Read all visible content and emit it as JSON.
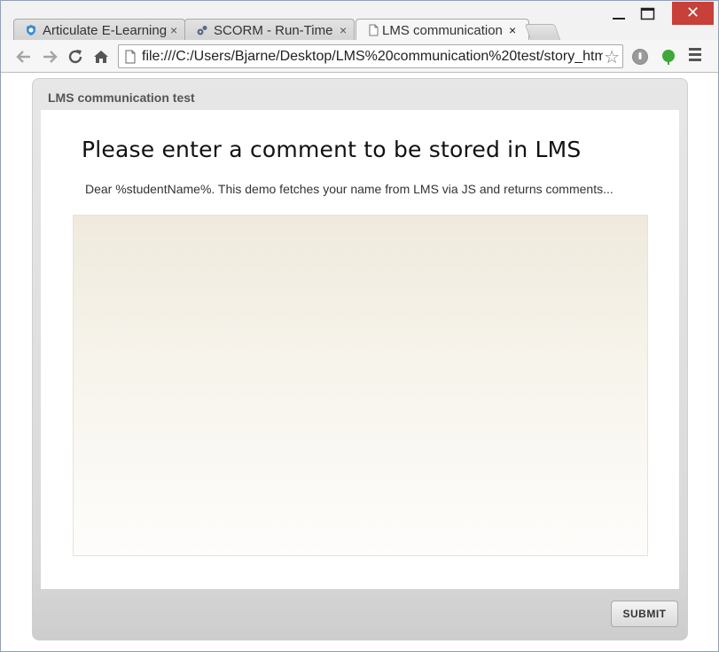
{
  "browser": {
    "tabs": [
      {
        "title": "Articulate E-Learning",
        "close": "×"
      },
      {
        "title": "SCORM - Run-Time E",
        "close": "×"
      },
      {
        "title": "LMS communication",
        "close": "×"
      }
    ],
    "window_controls": {
      "close_glyph": "✕"
    },
    "address_bar": {
      "url": "file:///C:/Users/Bjarne/Desktop/LMS%20communication%20test/story_htm"
    }
  },
  "player": {
    "title": "LMS communication test",
    "slide": {
      "heading": "Please enter a comment to be stored in LMS",
      "subtext": "Dear %studentName%. This demo fetches your name from LMS via JS and returns comments...",
      "comment_value": ""
    },
    "submit_label": "SUBMIT"
  },
  "colors": {
    "close_button": "#c7403a",
    "comment_area_top": "#efeadd",
    "player_frame": "#e7e7e7"
  }
}
